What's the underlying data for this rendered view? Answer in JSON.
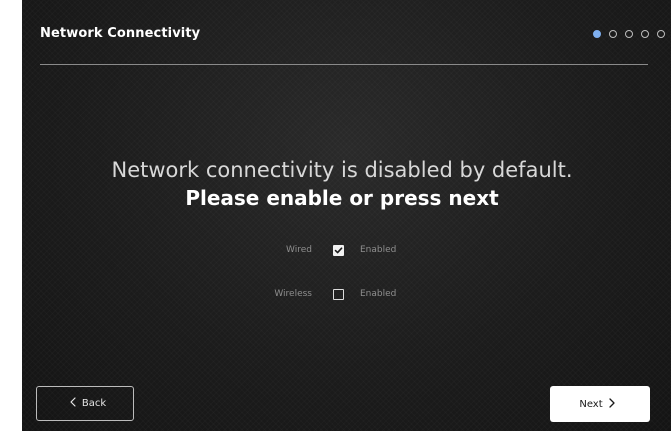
{
  "header": {
    "title": "Network Connectivity",
    "steps_total": 5,
    "active_step": 1
  },
  "main": {
    "line1": "Network connectivity is disabled by default.",
    "line2": "Please enable or press next"
  },
  "options": [
    {
      "label": "Wired",
      "checked": true,
      "state_label": "Enabled"
    },
    {
      "label": "Wireless",
      "checked": false,
      "state_label": "Enabled"
    }
  ],
  "footer": {
    "back_label": "Back",
    "next_label": "Next"
  },
  "colors": {
    "background": "#1b1b1b",
    "accent": "#7fb0f0",
    "text_primary": "#ffffff",
    "text_muted": "#8e8e8e"
  }
}
